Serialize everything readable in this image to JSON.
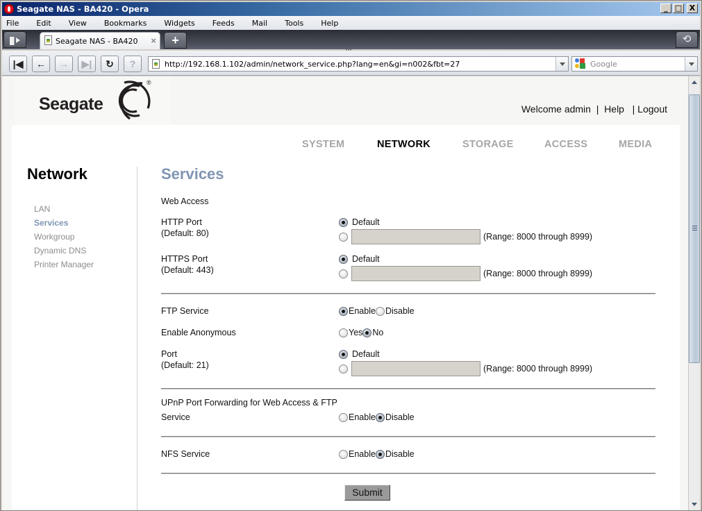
{
  "window": {
    "title": "Seagate NAS - BA420 - Opera",
    "controls": {
      "minimize": "_",
      "maximize": "□",
      "close": "X"
    }
  },
  "menubar": {
    "items": [
      "File",
      "Edit",
      "View",
      "Bookmarks",
      "Widgets",
      "Feeds",
      "Mail",
      "Tools",
      "Help"
    ]
  },
  "tabs": {
    "active_tab": {
      "label": "Seagate NAS - BA420",
      "close": "×"
    },
    "new_tab": "+",
    "closed_tabs_icon": "⟲"
  },
  "toolbar": {
    "buttons": {
      "rewind": "|◀",
      "back": "←",
      "forward": "→",
      "fast_forward": "▶|",
      "reload": "↻",
      "security": "?"
    },
    "address": {
      "url": "http://192.168.1.102/admin/network_service.php?lang=en&gi=n002&fbt=27"
    },
    "search": {
      "engine": "Google",
      "placeholder": "Google"
    }
  },
  "page": {
    "brand": {
      "name": "Seagate",
      "reg": "®"
    },
    "userbar": {
      "welcome": "Welcome admin",
      "sep1": "  |  ",
      "help": "Help",
      "sep2": "   | ",
      "logout": "Logout"
    },
    "topnav": [
      {
        "label": "SYSTEM",
        "active": false
      },
      {
        "label": "NETWORK",
        "active": true
      },
      {
        "label": "STORAGE",
        "active": false
      },
      {
        "label": "ACCESS",
        "active": false
      },
      {
        "label": "MEDIA",
        "active": false
      }
    ],
    "sidebar": {
      "title": "Network",
      "items": [
        {
          "label": "LAN",
          "active": false
        },
        {
          "label": "Services",
          "active": true
        },
        {
          "label": "Workgroup",
          "active": false
        },
        {
          "label": "Dynamic DNS",
          "active": false
        },
        {
          "label": "Printer Manager",
          "active": false
        }
      ]
    },
    "main": {
      "title": "Services",
      "web_access": {
        "heading": "Web Access",
        "http": {
          "label": "HTTP Port",
          "sublabel": "(Default: 80)",
          "default_option": "Default",
          "selected": "default",
          "custom_value": "",
          "range": "(Range: 8000 through 8999)"
        },
        "https": {
          "label": "HTTPS Port",
          "sublabel": "(Default: 443)",
          "default_option": "Default",
          "selected": "default",
          "custom_value": "",
          "range": "(Range: 8000 through 8999)"
        }
      },
      "ftp": {
        "service": {
          "label": "FTP Service",
          "options": [
            "Enable",
            "Disable"
          ],
          "selected": "Enable"
        },
        "anonymous": {
          "label": "Enable Anonymous",
          "options": [
            "Yes",
            "No"
          ],
          "selected": "No"
        },
        "port": {
          "label": "Port",
          "sublabel": "(Default: 21)",
          "default_option": "Default",
          "selected": "default",
          "custom_value": "",
          "range": "(Range: 8000 through 8999)"
        }
      },
      "upnp": {
        "heading": "UPnP Port Forwarding for Web Access & FTP",
        "label": "Service",
        "options": [
          "Enable",
          "Disable"
        ],
        "selected": "Disable"
      },
      "nfs": {
        "label": "NFS Service",
        "options": [
          "Enable",
          "Disable"
        ],
        "selected": "Disable"
      },
      "submit_label": "Submit"
    }
  },
  "colors": {
    "accent": "#7f95b3",
    "nav_inactive": "#a6a6a6",
    "sidebar_inactive": "#8c8c8c",
    "input_disabled_bg": "#d6d2cc"
  }
}
